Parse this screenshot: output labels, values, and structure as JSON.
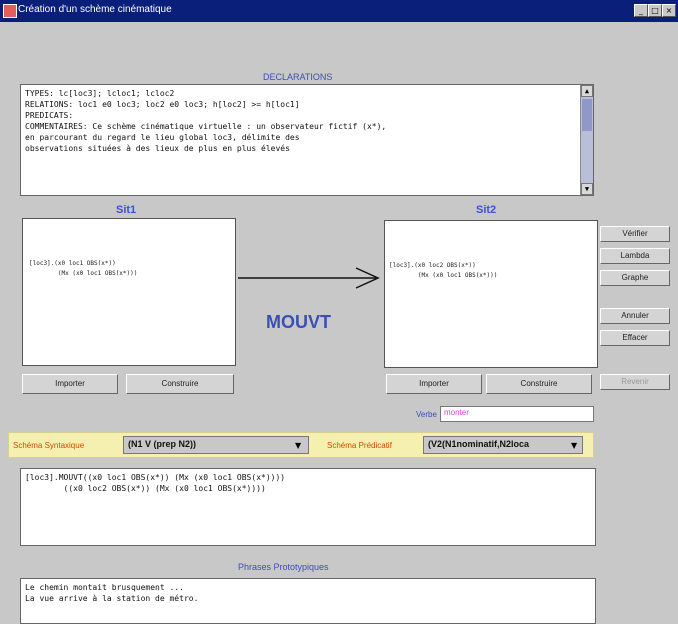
{
  "window": {
    "title": "Création d'un schème cinématique",
    "controls": [
      "_",
      "□",
      "×"
    ]
  },
  "declarations": {
    "label": "DECLARATIONS",
    "lines": [
      "TYPES: lc[loc3]; lcloc1; lcloc2",
      "RELATIONS: loc1 e0 loc3; loc2 e0 loc3; h[loc2] >= h[loc1]",
      "PREDICATS:",
      "COMMENTAIRES: Ce schème cinématique virtuelle : un observateur fictif (x*),",
      "en parcourant du regard le lieu global loc3, délimite des",
      "observations situées à des lieux de plus en plus élevés"
    ]
  },
  "sit1": {
    "title": "Sit1",
    "lines": [
      "[loc3].(x0 loc1 OBS(x*))",
      "        (Mx (x0 loc1 OBS(x*)))"
    ],
    "import_label": "Importer",
    "construct_label": "Construire"
  },
  "sit2": {
    "title": "Sit2",
    "lines": [
      "[loc3].(x0 loc2 OBS(x*))",
      "        (Mx (x0 loc1 OBS(x*)))"
    ],
    "import_label": "Importer",
    "construct_label": "Construire"
  },
  "transition_label": "MOUVT",
  "side_buttons": [
    "Vérifier",
    "Lambda",
    "Graphe",
    "Annuler",
    "Effacer"
  ],
  "revenir_label": "Revenir",
  "verbe": {
    "label": "Verbe",
    "value": "monter"
  },
  "schema_syntaxique": {
    "label": "Schéma Syntaxique",
    "value": "(N1 V (prep N2))"
  },
  "schema_predicatif": {
    "label": "Schéma Prédicatif",
    "value": "(V2(N1nominatif,N2loca"
  },
  "formula_lines": [
    "[loc3].MOUVT((x0 loc1 OBS(x*)) (Mx (x0 loc1 OBS(x*))))",
    "        ((x0 loc2 OBS(x*)) (Mx (x0 loc1 OBS(x*))))"
  ],
  "phrases": {
    "label": "Phrases Prototypiques",
    "lines": [
      "Le chemin montait brusquement ...",
      "La vue arrive à la station de métro."
    ]
  }
}
